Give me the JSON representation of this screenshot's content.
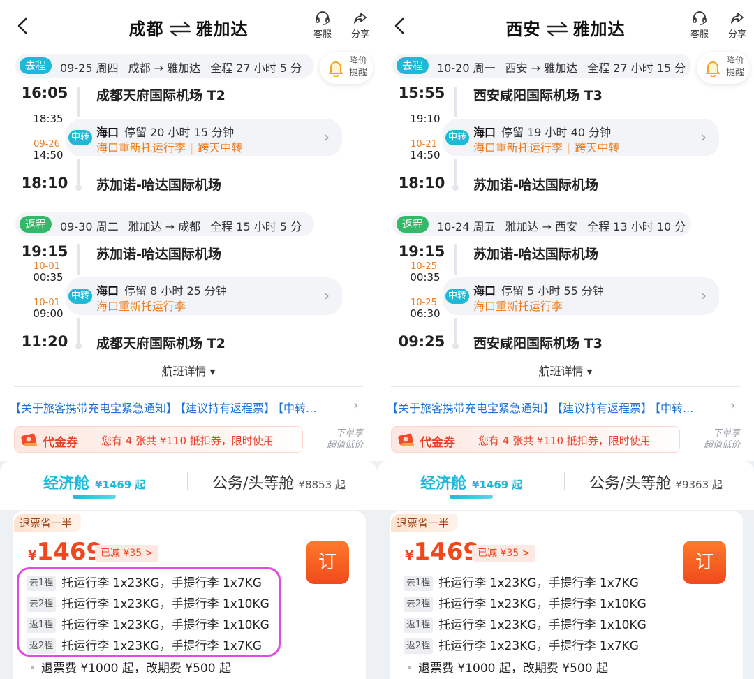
{
  "panels": [
    {
      "title_from": "成都",
      "title_to": "雅加达",
      "customer_service": "客服",
      "share": "分享",
      "price_alert_line1": "降价",
      "price_alert_line2": "提醒",
      "outbound": {
        "tag": "去程",
        "date": "09-25 周四",
        "route": "成都 → 雅加达",
        "duration": "全程 27 小时 5 分",
        "dep_time": "16:05",
        "dep_airport": "成都天府国际机场 T2",
        "transfer_arr_time": "18:35",
        "transfer_dep_date": "09-26",
        "transfer_dep_time": "14:50",
        "transfer_badge": "中转",
        "transfer_city": "海口",
        "transfer_stay": "停留 20 小时 15 分钟",
        "transfer_note1": "海口重新托运行李",
        "transfer_note2": "跨天中转",
        "arr_time": "18:10",
        "arr_airport": "苏加诺-哈达国际机场"
      },
      "return": {
        "tag": "返程",
        "date": "09-30 周二",
        "route": "雅加达 → 成都",
        "duration": "全程 15 小时 5 分",
        "dep_time": "19:15",
        "dep_airport": "苏加诺-哈达国际机场",
        "transfer_arr_date": "10-01",
        "transfer_arr_time": "00:35",
        "transfer_dep_date": "10-01",
        "transfer_dep_time": "09:00",
        "transfer_badge": "中转",
        "transfer_city": "海口",
        "transfer_stay": "停留 8 小时 25 分钟",
        "transfer_note1": "海口重新托运行李",
        "arr_time": "11:20",
        "arr_airport": "成都天府国际机场 T2"
      },
      "flight_detail": "航班详情 ▾",
      "notices": [
        "【关于旅客携带充电宝紧急通知】",
        "【建议持有返程票】",
        "【中转..."
      ],
      "coupon_name": "代金券",
      "coupon_desc": "您有 4 张共 ¥110 抵扣券，限时使用",
      "coupon_side_line1": "下单享",
      "coupon_side_line2": "超值低价",
      "economy_label": "经济舱",
      "economy_price": "¥1469 起",
      "business_label": "公务/头等舱",
      "business_price": "¥8853 起",
      "refund_tag": "退票省一半",
      "currency": "¥",
      "price": "1469",
      "discount": "已减 ¥35 >",
      "book_label": "订",
      "baggage": [
        {
          "seg": "去1程",
          "text": "托运行李 1x23KG，手提行李 1x7KG"
        },
        {
          "seg": "去2程",
          "text": "托运行李 1x23KG，手提行李 1x10KG"
        },
        {
          "seg": "返1程",
          "text": "托运行李 1x23KG，手提行李 1x10KG"
        },
        {
          "seg": "返2程",
          "text": "托运行李 1x23KG，手提行李 1x7KG"
        }
      ],
      "fees": "退票费 ¥1000 起，改期费 ¥500 起"
    },
    {
      "title_from": "西安",
      "title_to": "雅加达",
      "customer_service": "客服",
      "share": "分享",
      "price_alert_line1": "降价",
      "price_alert_line2": "提醒",
      "outbound": {
        "tag": "去程",
        "date": "10-20 周一",
        "route": "西安 → 雅加达",
        "duration": "全程 27 小时 15 分",
        "dep_time": "15:55",
        "dep_airport": "西安咸阳国际机场 T3",
        "transfer_arr_time": "19:10",
        "transfer_dep_date": "10-21",
        "transfer_dep_time": "14:50",
        "transfer_badge": "中转",
        "transfer_city": "海口",
        "transfer_stay": "停留 19 小时 40 分钟",
        "transfer_note1": "海口重新托运行李",
        "transfer_note2": "跨天中转",
        "arr_time": "18:10",
        "arr_airport": "苏加诺-哈达国际机场"
      },
      "return": {
        "tag": "返程",
        "date": "10-24 周五",
        "route": "雅加达 → 西安",
        "duration": "全程 13 小时 10 分",
        "dep_time": "19:15",
        "dep_airport": "苏加诺-哈达国际机场",
        "transfer_arr_date": "10-25",
        "transfer_arr_time": "00:35",
        "transfer_dep_date": "10-25",
        "transfer_dep_time": "06:30",
        "transfer_badge": "中转",
        "transfer_city": "海口",
        "transfer_stay": "停留 5 小时 55 分钟",
        "transfer_note1": "海口重新托运行李",
        "arr_time": "09:25",
        "arr_airport": "西安咸阳国际机场 T3"
      },
      "flight_detail": "航班详情 ▾",
      "notices": [
        "【关于旅客携带充电宝紧急通知】",
        "【建议持有返程票】",
        "【中转..."
      ],
      "coupon_name": "代金券",
      "coupon_desc": "您有 4 张共 ¥110 抵扣券，限时使用",
      "coupon_side_line1": "下单享",
      "coupon_side_line2": "超值低价",
      "economy_label": "经济舱",
      "economy_price": "¥1469 起",
      "business_label": "公务/头等舱",
      "business_price": "¥9363 起",
      "refund_tag": "退票省一半",
      "currency": "¥",
      "price": "1469",
      "discount": "已减 ¥35 >",
      "book_label": "订",
      "baggage": [
        {
          "seg": "去1程",
          "text": "托运行李 1x23KG，手提行李 1x7KG"
        },
        {
          "seg": "去2程",
          "text": "托运行李 1x23KG，手提行李 1x10KG"
        },
        {
          "seg": "返1程",
          "text": "托运行李 1x23KG，手提行李 1x10KG"
        },
        {
          "seg": "返2程",
          "text": "托运行李 1x23KG，手提行李 1x7KG"
        }
      ],
      "fees": "退票费 ¥1000 起，改期费 ¥500 起"
    }
  ],
  "colors": {
    "accent_cyan": "#1fb9d8",
    "return_green": "#35b86a",
    "orange_note": "#f07b1c",
    "price_red": "#f0471f",
    "highlight_magenta": "#e04ce0",
    "notice_blue": "#1c72d8"
  },
  "icons": [
    "back-arrow-icon",
    "swap-arrows-icon",
    "headset-icon",
    "share-icon",
    "bell-icon",
    "chevron-right-icon",
    "coupon-icon"
  ]
}
